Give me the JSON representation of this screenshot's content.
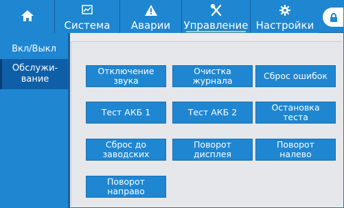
{
  "header": {
    "tabs": [
      {
        "label": "Система",
        "icon": "chart-icon"
      },
      {
        "label": "Аварии",
        "icon": "warning-icon"
      },
      {
        "label": "Управление",
        "icon": "tools-icon",
        "active": true
      },
      {
        "label": "Настройки",
        "icon": "gear-icon"
      }
    ]
  },
  "sidebar": {
    "items": [
      {
        "label": "Вкл/Выкл"
      },
      {
        "label": "Обслужи-\nвание",
        "active": true
      }
    ]
  },
  "buttons": [
    {
      "label": "Отключение\nзвука"
    },
    {
      "label": "Очистка\nжурнала"
    },
    {
      "label": "Сброс ошибок"
    },
    {
      "label": "Тест АКБ 1"
    },
    {
      "label": "Тест АКБ 2"
    },
    {
      "label": "Остановка\nтеста"
    },
    {
      "label": "Сброс до\nзаводских"
    },
    {
      "label": "Поворот\nдисплея"
    },
    {
      "label": "Поворот\nналево"
    },
    {
      "label": "Поворот\nнаправо"
    }
  ],
  "colors": {
    "primary": "#1f86d1",
    "sidebar_active": "#0f5fa8",
    "tab_underline": "#f3c23d"
  }
}
